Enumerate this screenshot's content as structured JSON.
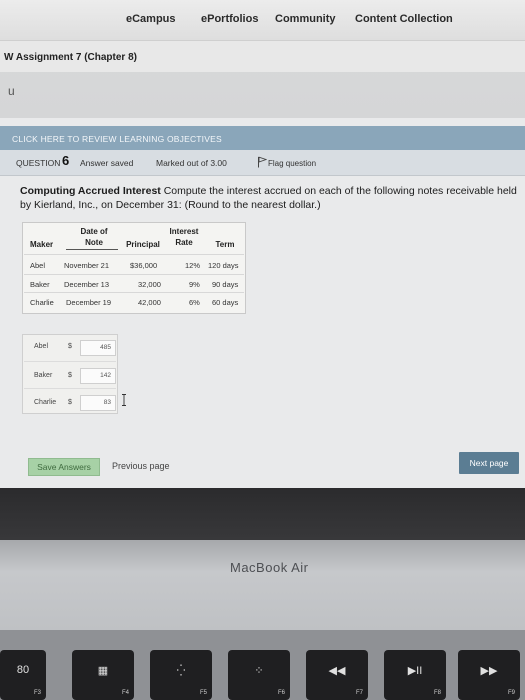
{
  "nav": {
    "items": [
      "eCampus",
      "ePortfolios",
      "Community",
      "Content Collection"
    ]
  },
  "assignment": {
    "title": "W Assignment 7 (Chapter 8)",
    "letter": "u"
  },
  "objectives": {
    "link": "CLICK HERE TO REVIEW LEARNING OBJECTIVES"
  },
  "question": {
    "label": "QUESTION",
    "number": "6",
    "status": "Answer saved",
    "marked": "Marked out of 3.00",
    "flag": "Flag question"
  },
  "prompt": {
    "title": "Computing Accrued Interest",
    "text": " Compute the interest accrued on each of the following notes receivable held by Kierland, Inc., on December 31: (Round to the nearest dollar.)"
  },
  "table": {
    "headers": {
      "maker": "Maker",
      "date_top": "Date of",
      "date_bottom": "Note",
      "principal": "Principal",
      "rate_top": "Interest",
      "rate_bottom": "Rate",
      "term": "Term"
    },
    "rows": [
      {
        "maker": "Abel",
        "date": "November 21",
        "principal": "$36,000",
        "rate": "12%",
        "term": "120 days"
      },
      {
        "maker": "Baker",
        "date": "December 13",
        "principal": "32,000",
        "rate": "9%",
        "term": "90 days"
      },
      {
        "maker": "Charlie",
        "date": "December 19",
        "principal": "42,000",
        "rate": "6%",
        "term": "60 days"
      }
    ]
  },
  "answers": [
    {
      "label": "Abel",
      "currency": "$",
      "value": "485"
    },
    {
      "label": "Baker",
      "currency": "$",
      "value": "142"
    },
    {
      "label": "Charlie",
      "currency": "$",
      "value": "83"
    }
  ],
  "buttons": {
    "save": "Save Answers",
    "previous": "Previous page",
    "next": "Next page"
  },
  "laptop": {
    "brand": "MacBook Air",
    "keys": [
      {
        "glyph": "80",
        "label": "F3"
      },
      {
        "glyph": "▦",
        "label": "F4"
      },
      {
        "glyph": "⁛",
        "label": "F5"
      },
      {
        "glyph": "⁘",
        "label": "F6"
      },
      {
        "glyph": "◀◀",
        "label": "F7"
      },
      {
        "glyph": "▶II",
        "label": "F8"
      },
      {
        "glyph": "▶▶",
        "label": "F9"
      }
    ]
  },
  "colors": {
    "objectives_bar": "#8aa6ba",
    "save_button": "#a7d1a6",
    "next_button": "#5b7d93"
  }
}
